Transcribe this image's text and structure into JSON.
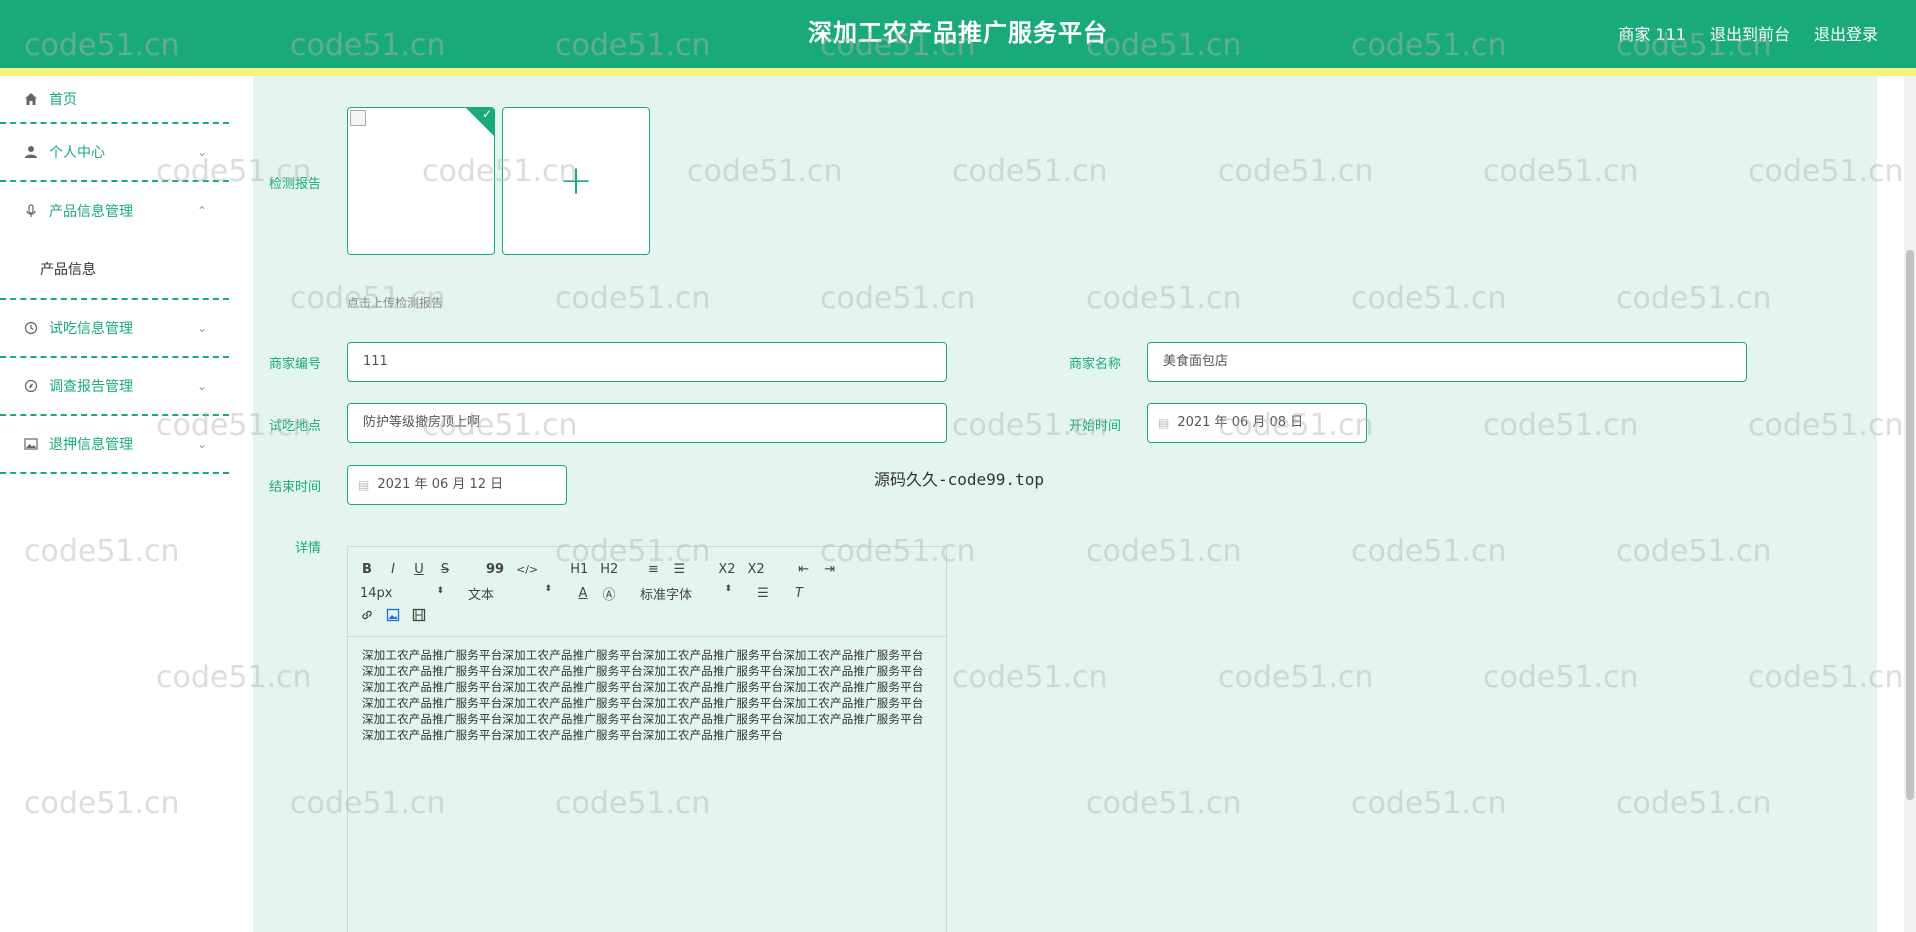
{
  "header": {
    "title": "深加工农产品推广服务平台",
    "user_label": "商家 111",
    "exit_front": "退出到前台",
    "logout": "退出登录"
  },
  "sidebar": {
    "items": [
      {
        "label": "首页",
        "icon": "home-icon"
      },
      {
        "label": "个人中心",
        "icon": "user-icon"
      },
      {
        "label": "产品信息管理",
        "icon": "microphone-icon"
      },
      {
        "label": "试吃信息管理",
        "icon": "clock-icon"
      },
      {
        "label": "调查报告管理",
        "icon": "compass-icon"
      },
      {
        "label": "退押信息管理",
        "icon": "picture-icon"
      }
    ],
    "sub_item": "产品信息"
  },
  "form": {
    "report_label": "检测报告",
    "upload_tip": "点击上传检测报告",
    "merchant_no_label": "商家编号",
    "merchant_no": "111",
    "merchant_name_label": "商家名称",
    "merchant_name": "美食面包店",
    "tasting_place_label": "试吃地点",
    "tasting_place": "防护等级撤房顶上啊",
    "start_label": "开始时间",
    "start_date": "2021 年 06 月 08 日",
    "end_label": "结束时间",
    "end_date": "2021 年 06 月 12 日",
    "detail_label": "详情"
  },
  "editor": {
    "row1": [
      "B",
      "I",
      "U",
      "S",
      "99",
      "</>",
      "H1",
      "H2",
      "≡",
      "☰",
      "X2",
      "X2",
      "⇤",
      "⇥"
    ],
    "font_size": "14px",
    "text_type": "文本",
    "font_family": "标准字体",
    "content": "深加工农产品推广服务平台深加工农产品推广服务平台深加工农产品推广服务平台深加工农产品推广服务平台深加工农产品推广服务平台深加工农产品推广服务平台深加工农产品推广服务平台深加工农产品推广服务平台深加工农产品推广服务平台深加工农产品推广服务平台深加工农产品推广服务平台深加工农产品推广服务平台深加工农产品推广服务平台深加工农产品推广服务平台深加工农产品推广服务平台深加工农产品推广服务平台深加工农产品推广服务平台深加工农产品推广服务平台深加工农产品推广服务平台深加工农产品推广服务平台深加工农产品推广服务平台深加工农产品推广服务平台深加工农产品推广服务平台"
  },
  "center_note": "源码久久-code99.top",
  "watermark": "code51.cn"
}
